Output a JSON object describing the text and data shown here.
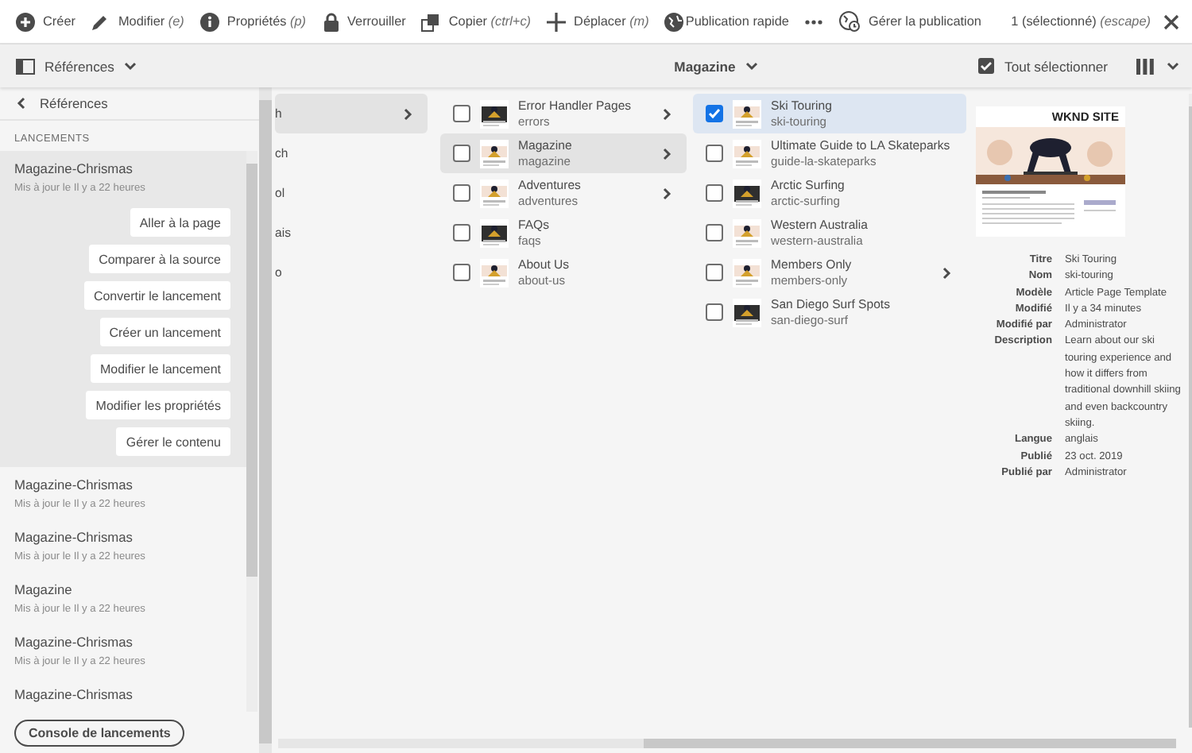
{
  "toolbar": {
    "actions": [
      {
        "kind": "create",
        "label": "Créer"
      },
      {
        "kind": "edit",
        "label": "Modifier",
        "shortcut": "(e)"
      },
      {
        "kind": "info",
        "label": "Propriétés",
        "shortcut": "(p)"
      },
      {
        "kind": "lock",
        "label": "Verrouiller"
      },
      {
        "kind": "copy",
        "label": "Copier",
        "shortcut": "(ctrl+c)"
      },
      {
        "kind": "move",
        "label": "Déplacer",
        "shortcut": "(m)"
      },
      {
        "kind": "globe",
        "label": "Publication rapide"
      },
      {
        "kind": "more"
      },
      {
        "kind": "manage",
        "label": "Gérer la publication"
      }
    ],
    "selection": {
      "count": "1 (sélectionné)",
      "shortcut": "(escape)"
    }
  },
  "subbar": {
    "rail": "Références",
    "title": "Magazine",
    "select_all": "Tout sélectionner"
  },
  "panel": {
    "back": "Références",
    "section": "LANCEMENTS",
    "launches": [
      {
        "title": "Magazine-Chrismas",
        "updated": "Mis à jour le Il y a 22 heures",
        "expanded": true,
        "actions": [
          "Aller à la page",
          "Comparer à la source",
          "Convertir le lancement",
          "Créer un lancement",
          "Modifier le lancement",
          "Modifier les propriétés",
          "Gérer le contenu"
        ]
      },
      {
        "title": "Magazine-Chrismas",
        "updated": "Mis à jour le Il y a 22 heures",
        "expanded": false
      },
      {
        "title": "Magazine-Chrismas",
        "updated": "Mis à jour le Il y a 22 heures",
        "expanded": false
      },
      {
        "title": "Magazine",
        "updated": "Mis à jour le Il y a 22 heures",
        "expanded": false
      },
      {
        "title": "Magazine-Chrismas",
        "updated": "Mis à jour le Il y a 22 heures",
        "expanded": false
      },
      {
        "title": "Magazine-Chrismas",
        "expanded": false
      }
    ],
    "console": "Console de lancements"
  },
  "columns": [
    {
      "items": [
        {
          "title": "h",
          "selected": true,
          "has_children": true
        },
        {
          "title": "ch",
          "selected": false,
          "has_children": false
        },
        {
          "title": "ol",
          "selected": false,
          "has_children": false
        },
        {
          "title": "ais",
          "selected": false,
          "has_children": false
        },
        {
          "title": "o",
          "selected": false,
          "has_children": false
        }
      ]
    },
    {
      "items": [
        {
          "title": "Error Handler Pages",
          "name": "errors",
          "selected": false,
          "checked": false,
          "has_children": true
        },
        {
          "title": "Magazine",
          "name": "magazine",
          "selected": true,
          "checked": false,
          "has_children": true
        },
        {
          "title": "Adventures",
          "name": "adventures",
          "selected": false,
          "checked": false,
          "has_children": true
        },
        {
          "title": "FAQs",
          "name": "faqs",
          "selected": false,
          "checked": false,
          "has_children": false
        },
        {
          "title": "About Us",
          "name": "about-us",
          "selected": false,
          "checked": false,
          "has_children": false
        }
      ]
    },
    {
      "items": [
        {
          "title": "Ski Touring",
          "name": "ski-touring",
          "selected": true,
          "checked": true,
          "has_children": false
        },
        {
          "title": "Ultimate Guide to LA Skateparks",
          "name": "guide-la-skateparks",
          "selected": false,
          "checked": false,
          "has_children": false
        },
        {
          "title": "Arctic Surfing",
          "name": "arctic-surfing",
          "selected": false,
          "checked": false,
          "has_children": false
        },
        {
          "title": "Western Australia",
          "name": "western-australia",
          "selected": false,
          "checked": false,
          "has_children": false
        },
        {
          "title": "Members Only",
          "name": "members-only",
          "selected": false,
          "checked": false,
          "has_children": true
        },
        {
          "title": "San Diego Surf Spots",
          "name": "san-diego-surf",
          "selected": false,
          "checked": false,
          "has_children": false
        }
      ]
    }
  ],
  "preview": {
    "site": "WKND SITE",
    "properties": [
      {
        "label": "Titre",
        "value": "Ski Touring"
      },
      {
        "label": "Nom",
        "value": "ski-touring"
      },
      {
        "label": "Modèle",
        "value": "Article Page Template"
      },
      {
        "label": "Modifié",
        "value": "Il y a 34 minutes"
      },
      {
        "label": "Modifié par",
        "value": "Administrator"
      },
      {
        "label": "Description",
        "value": "Learn about our ski touring experience and how it differs from traditional downhill skiing and even backcountry skiing."
      },
      {
        "label": "Langue",
        "value": "anglais"
      },
      {
        "label": "Publié",
        "value": "23 oct. 2019"
      },
      {
        "label": "Publié par",
        "value": "Administrator"
      }
    ]
  }
}
